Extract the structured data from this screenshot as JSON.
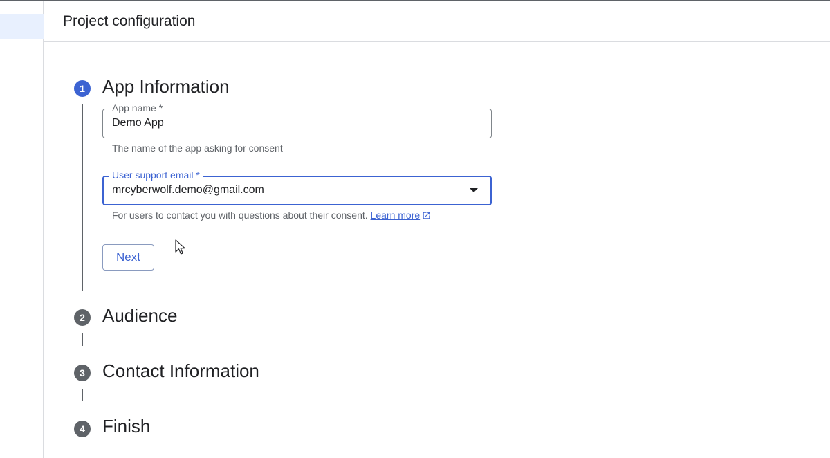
{
  "header": {
    "title": "Project configuration"
  },
  "steps": [
    {
      "number": "1",
      "title": "App Information",
      "active": true
    },
    {
      "number": "2",
      "title": "Audience",
      "active": false
    },
    {
      "number": "3",
      "title": "Contact Information",
      "active": false
    },
    {
      "number": "4",
      "title": "Finish",
      "active": false
    }
  ],
  "form": {
    "app_name": {
      "label": "App name *",
      "value": "Demo App",
      "helper": "The name of the app asking for consent"
    },
    "support_email": {
      "label": "User support email *",
      "value": "mrcyberwolf.demo@gmail.com",
      "helper": "For users to contact you with questions about their consent.",
      "link": "Learn more"
    },
    "next_label": "Next"
  },
  "colors": {
    "accent": "#3c63d2",
    "step_inactive": "#5f6368",
    "nav_active_bg": "#e8f0fe"
  },
  "icons": [
    "chevron-down-icon",
    "external-link-icon",
    "mouse-cursor-icon"
  ]
}
